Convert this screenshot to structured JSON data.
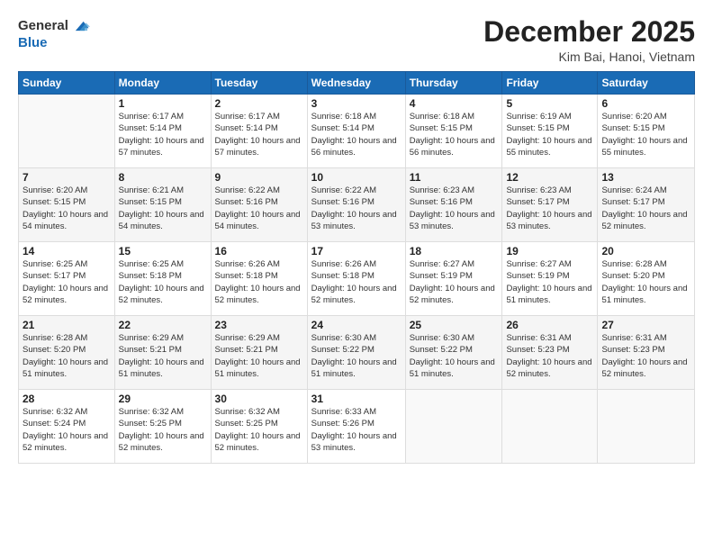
{
  "logo": {
    "general": "General",
    "blue": "Blue"
  },
  "title": "December 2025",
  "location": "Kim Bai, Hanoi, Vietnam",
  "weekdays": [
    "Sunday",
    "Monday",
    "Tuesday",
    "Wednesday",
    "Thursday",
    "Friday",
    "Saturday"
  ],
  "weeks": [
    [
      {
        "day": "",
        "sunrise": "",
        "sunset": "",
        "daylight": ""
      },
      {
        "day": "1",
        "sunrise": "Sunrise: 6:17 AM",
        "sunset": "Sunset: 5:14 PM",
        "daylight": "Daylight: 10 hours and 57 minutes."
      },
      {
        "day": "2",
        "sunrise": "Sunrise: 6:17 AM",
        "sunset": "Sunset: 5:14 PM",
        "daylight": "Daylight: 10 hours and 57 minutes."
      },
      {
        "day": "3",
        "sunrise": "Sunrise: 6:18 AM",
        "sunset": "Sunset: 5:14 PM",
        "daylight": "Daylight: 10 hours and 56 minutes."
      },
      {
        "day": "4",
        "sunrise": "Sunrise: 6:18 AM",
        "sunset": "Sunset: 5:15 PM",
        "daylight": "Daylight: 10 hours and 56 minutes."
      },
      {
        "day": "5",
        "sunrise": "Sunrise: 6:19 AM",
        "sunset": "Sunset: 5:15 PM",
        "daylight": "Daylight: 10 hours and 55 minutes."
      },
      {
        "day": "6",
        "sunrise": "Sunrise: 6:20 AM",
        "sunset": "Sunset: 5:15 PM",
        "daylight": "Daylight: 10 hours and 55 minutes."
      }
    ],
    [
      {
        "day": "7",
        "sunrise": "Sunrise: 6:20 AM",
        "sunset": "Sunset: 5:15 PM",
        "daylight": "Daylight: 10 hours and 54 minutes."
      },
      {
        "day": "8",
        "sunrise": "Sunrise: 6:21 AM",
        "sunset": "Sunset: 5:15 PM",
        "daylight": "Daylight: 10 hours and 54 minutes."
      },
      {
        "day": "9",
        "sunrise": "Sunrise: 6:22 AM",
        "sunset": "Sunset: 5:16 PM",
        "daylight": "Daylight: 10 hours and 54 minutes."
      },
      {
        "day": "10",
        "sunrise": "Sunrise: 6:22 AM",
        "sunset": "Sunset: 5:16 PM",
        "daylight": "Daylight: 10 hours and 53 minutes."
      },
      {
        "day": "11",
        "sunrise": "Sunrise: 6:23 AM",
        "sunset": "Sunset: 5:16 PM",
        "daylight": "Daylight: 10 hours and 53 minutes."
      },
      {
        "day": "12",
        "sunrise": "Sunrise: 6:23 AM",
        "sunset": "Sunset: 5:17 PM",
        "daylight": "Daylight: 10 hours and 53 minutes."
      },
      {
        "day": "13",
        "sunrise": "Sunrise: 6:24 AM",
        "sunset": "Sunset: 5:17 PM",
        "daylight": "Daylight: 10 hours and 52 minutes."
      }
    ],
    [
      {
        "day": "14",
        "sunrise": "Sunrise: 6:25 AM",
        "sunset": "Sunset: 5:17 PM",
        "daylight": "Daylight: 10 hours and 52 minutes."
      },
      {
        "day": "15",
        "sunrise": "Sunrise: 6:25 AM",
        "sunset": "Sunset: 5:18 PM",
        "daylight": "Daylight: 10 hours and 52 minutes."
      },
      {
        "day": "16",
        "sunrise": "Sunrise: 6:26 AM",
        "sunset": "Sunset: 5:18 PM",
        "daylight": "Daylight: 10 hours and 52 minutes."
      },
      {
        "day": "17",
        "sunrise": "Sunrise: 6:26 AM",
        "sunset": "Sunset: 5:18 PM",
        "daylight": "Daylight: 10 hours and 52 minutes."
      },
      {
        "day": "18",
        "sunrise": "Sunrise: 6:27 AM",
        "sunset": "Sunset: 5:19 PM",
        "daylight": "Daylight: 10 hours and 52 minutes."
      },
      {
        "day": "19",
        "sunrise": "Sunrise: 6:27 AM",
        "sunset": "Sunset: 5:19 PM",
        "daylight": "Daylight: 10 hours and 51 minutes."
      },
      {
        "day": "20",
        "sunrise": "Sunrise: 6:28 AM",
        "sunset": "Sunset: 5:20 PM",
        "daylight": "Daylight: 10 hours and 51 minutes."
      }
    ],
    [
      {
        "day": "21",
        "sunrise": "Sunrise: 6:28 AM",
        "sunset": "Sunset: 5:20 PM",
        "daylight": "Daylight: 10 hours and 51 minutes."
      },
      {
        "day": "22",
        "sunrise": "Sunrise: 6:29 AM",
        "sunset": "Sunset: 5:21 PM",
        "daylight": "Daylight: 10 hours and 51 minutes."
      },
      {
        "day": "23",
        "sunrise": "Sunrise: 6:29 AM",
        "sunset": "Sunset: 5:21 PM",
        "daylight": "Daylight: 10 hours and 51 minutes."
      },
      {
        "day": "24",
        "sunrise": "Sunrise: 6:30 AM",
        "sunset": "Sunset: 5:22 PM",
        "daylight": "Daylight: 10 hours and 51 minutes."
      },
      {
        "day": "25",
        "sunrise": "Sunrise: 6:30 AM",
        "sunset": "Sunset: 5:22 PM",
        "daylight": "Daylight: 10 hours and 51 minutes."
      },
      {
        "day": "26",
        "sunrise": "Sunrise: 6:31 AM",
        "sunset": "Sunset: 5:23 PM",
        "daylight": "Daylight: 10 hours and 52 minutes."
      },
      {
        "day": "27",
        "sunrise": "Sunrise: 6:31 AM",
        "sunset": "Sunset: 5:23 PM",
        "daylight": "Daylight: 10 hours and 52 minutes."
      }
    ],
    [
      {
        "day": "28",
        "sunrise": "Sunrise: 6:32 AM",
        "sunset": "Sunset: 5:24 PM",
        "daylight": "Daylight: 10 hours and 52 minutes."
      },
      {
        "day": "29",
        "sunrise": "Sunrise: 6:32 AM",
        "sunset": "Sunset: 5:25 PM",
        "daylight": "Daylight: 10 hours and 52 minutes."
      },
      {
        "day": "30",
        "sunrise": "Sunrise: 6:32 AM",
        "sunset": "Sunset: 5:25 PM",
        "daylight": "Daylight: 10 hours and 52 minutes."
      },
      {
        "day": "31",
        "sunrise": "Sunrise: 6:33 AM",
        "sunset": "Sunset: 5:26 PM",
        "daylight": "Daylight: 10 hours and 53 minutes."
      },
      {
        "day": "",
        "sunrise": "",
        "sunset": "",
        "daylight": ""
      },
      {
        "day": "",
        "sunrise": "",
        "sunset": "",
        "daylight": ""
      },
      {
        "day": "",
        "sunrise": "",
        "sunset": "",
        "daylight": ""
      }
    ]
  ]
}
